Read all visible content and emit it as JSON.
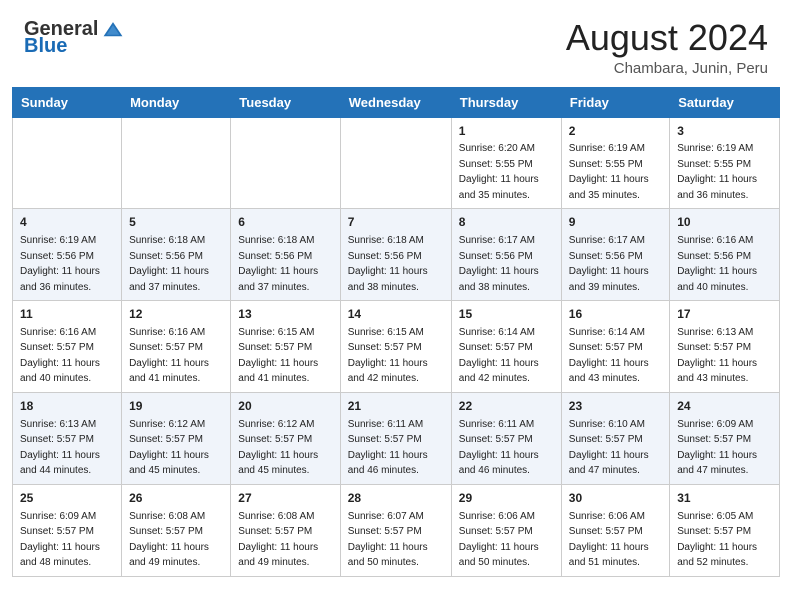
{
  "header": {
    "logo_general": "General",
    "logo_blue": "Blue",
    "month_year": "August 2024",
    "location": "Chambara, Junin, Peru"
  },
  "weekdays": [
    "Sunday",
    "Monday",
    "Tuesday",
    "Wednesday",
    "Thursday",
    "Friday",
    "Saturday"
  ],
  "weeks": [
    [
      {
        "day": "",
        "info": ""
      },
      {
        "day": "",
        "info": ""
      },
      {
        "day": "",
        "info": ""
      },
      {
        "day": "",
        "info": ""
      },
      {
        "day": "1",
        "info": "Sunrise: 6:20 AM\nSunset: 5:55 PM\nDaylight: 11 hours\nand 35 minutes."
      },
      {
        "day": "2",
        "info": "Sunrise: 6:19 AM\nSunset: 5:55 PM\nDaylight: 11 hours\nand 35 minutes."
      },
      {
        "day": "3",
        "info": "Sunrise: 6:19 AM\nSunset: 5:55 PM\nDaylight: 11 hours\nand 36 minutes."
      }
    ],
    [
      {
        "day": "4",
        "info": "Sunrise: 6:19 AM\nSunset: 5:56 PM\nDaylight: 11 hours\nand 36 minutes."
      },
      {
        "day": "5",
        "info": "Sunrise: 6:18 AM\nSunset: 5:56 PM\nDaylight: 11 hours\nand 37 minutes."
      },
      {
        "day": "6",
        "info": "Sunrise: 6:18 AM\nSunset: 5:56 PM\nDaylight: 11 hours\nand 37 minutes."
      },
      {
        "day": "7",
        "info": "Sunrise: 6:18 AM\nSunset: 5:56 PM\nDaylight: 11 hours\nand 38 minutes."
      },
      {
        "day": "8",
        "info": "Sunrise: 6:17 AM\nSunset: 5:56 PM\nDaylight: 11 hours\nand 38 minutes."
      },
      {
        "day": "9",
        "info": "Sunrise: 6:17 AM\nSunset: 5:56 PM\nDaylight: 11 hours\nand 39 minutes."
      },
      {
        "day": "10",
        "info": "Sunrise: 6:16 AM\nSunset: 5:56 PM\nDaylight: 11 hours\nand 40 minutes."
      }
    ],
    [
      {
        "day": "11",
        "info": "Sunrise: 6:16 AM\nSunset: 5:57 PM\nDaylight: 11 hours\nand 40 minutes."
      },
      {
        "day": "12",
        "info": "Sunrise: 6:16 AM\nSunset: 5:57 PM\nDaylight: 11 hours\nand 41 minutes."
      },
      {
        "day": "13",
        "info": "Sunrise: 6:15 AM\nSunset: 5:57 PM\nDaylight: 11 hours\nand 41 minutes."
      },
      {
        "day": "14",
        "info": "Sunrise: 6:15 AM\nSunset: 5:57 PM\nDaylight: 11 hours\nand 42 minutes."
      },
      {
        "day": "15",
        "info": "Sunrise: 6:14 AM\nSunset: 5:57 PM\nDaylight: 11 hours\nand 42 minutes."
      },
      {
        "day": "16",
        "info": "Sunrise: 6:14 AM\nSunset: 5:57 PM\nDaylight: 11 hours\nand 43 minutes."
      },
      {
        "day": "17",
        "info": "Sunrise: 6:13 AM\nSunset: 5:57 PM\nDaylight: 11 hours\nand 43 minutes."
      }
    ],
    [
      {
        "day": "18",
        "info": "Sunrise: 6:13 AM\nSunset: 5:57 PM\nDaylight: 11 hours\nand 44 minutes."
      },
      {
        "day": "19",
        "info": "Sunrise: 6:12 AM\nSunset: 5:57 PM\nDaylight: 11 hours\nand 45 minutes."
      },
      {
        "day": "20",
        "info": "Sunrise: 6:12 AM\nSunset: 5:57 PM\nDaylight: 11 hours\nand 45 minutes."
      },
      {
        "day": "21",
        "info": "Sunrise: 6:11 AM\nSunset: 5:57 PM\nDaylight: 11 hours\nand 46 minutes."
      },
      {
        "day": "22",
        "info": "Sunrise: 6:11 AM\nSunset: 5:57 PM\nDaylight: 11 hours\nand 46 minutes."
      },
      {
        "day": "23",
        "info": "Sunrise: 6:10 AM\nSunset: 5:57 PM\nDaylight: 11 hours\nand 47 minutes."
      },
      {
        "day": "24",
        "info": "Sunrise: 6:09 AM\nSunset: 5:57 PM\nDaylight: 11 hours\nand 47 minutes."
      }
    ],
    [
      {
        "day": "25",
        "info": "Sunrise: 6:09 AM\nSunset: 5:57 PM\nDaylight: 11 hours\nand 48 minutes."
      },
      {
        "day": "26",
        "info": "Sunrise: 6:08 AM\nSunset: 5:57 PM\nDaylight: 11 hours\nand 49 minutes."
      },
      {
        "day": "27",
        "info": "Sunrise: 6:08 AM\nSunset: 5:57 PM\nDaylight: 11 hours\nand 49 minutes."
      },
      {
        "day": "28",
        "info": "Sunrise: 6:07 AM\nSunset: 5:57 PM\nDaylight: 11 hours\nand 50 minutes."
      },
      {
        "day": "29",
        "info": "Sunrise: 6:06 AM\nSunset: 5:57 PM\nDaylight: 11 hours\nand 50 minutes."
      },
      {
        "day": "30",
        "info": "Sunrise: 6:06 AM\nSunset: 5:57 PM\nDaylight: 11 hours\nand 51 minutes."
      },
      {
        "day": "31",
        "info": "Sunrise: 6:05 AM\nSunset: 5:57 PM\nDaylight: 11 hours\nand 52 minutes."
      }
    ]
  ]
}
